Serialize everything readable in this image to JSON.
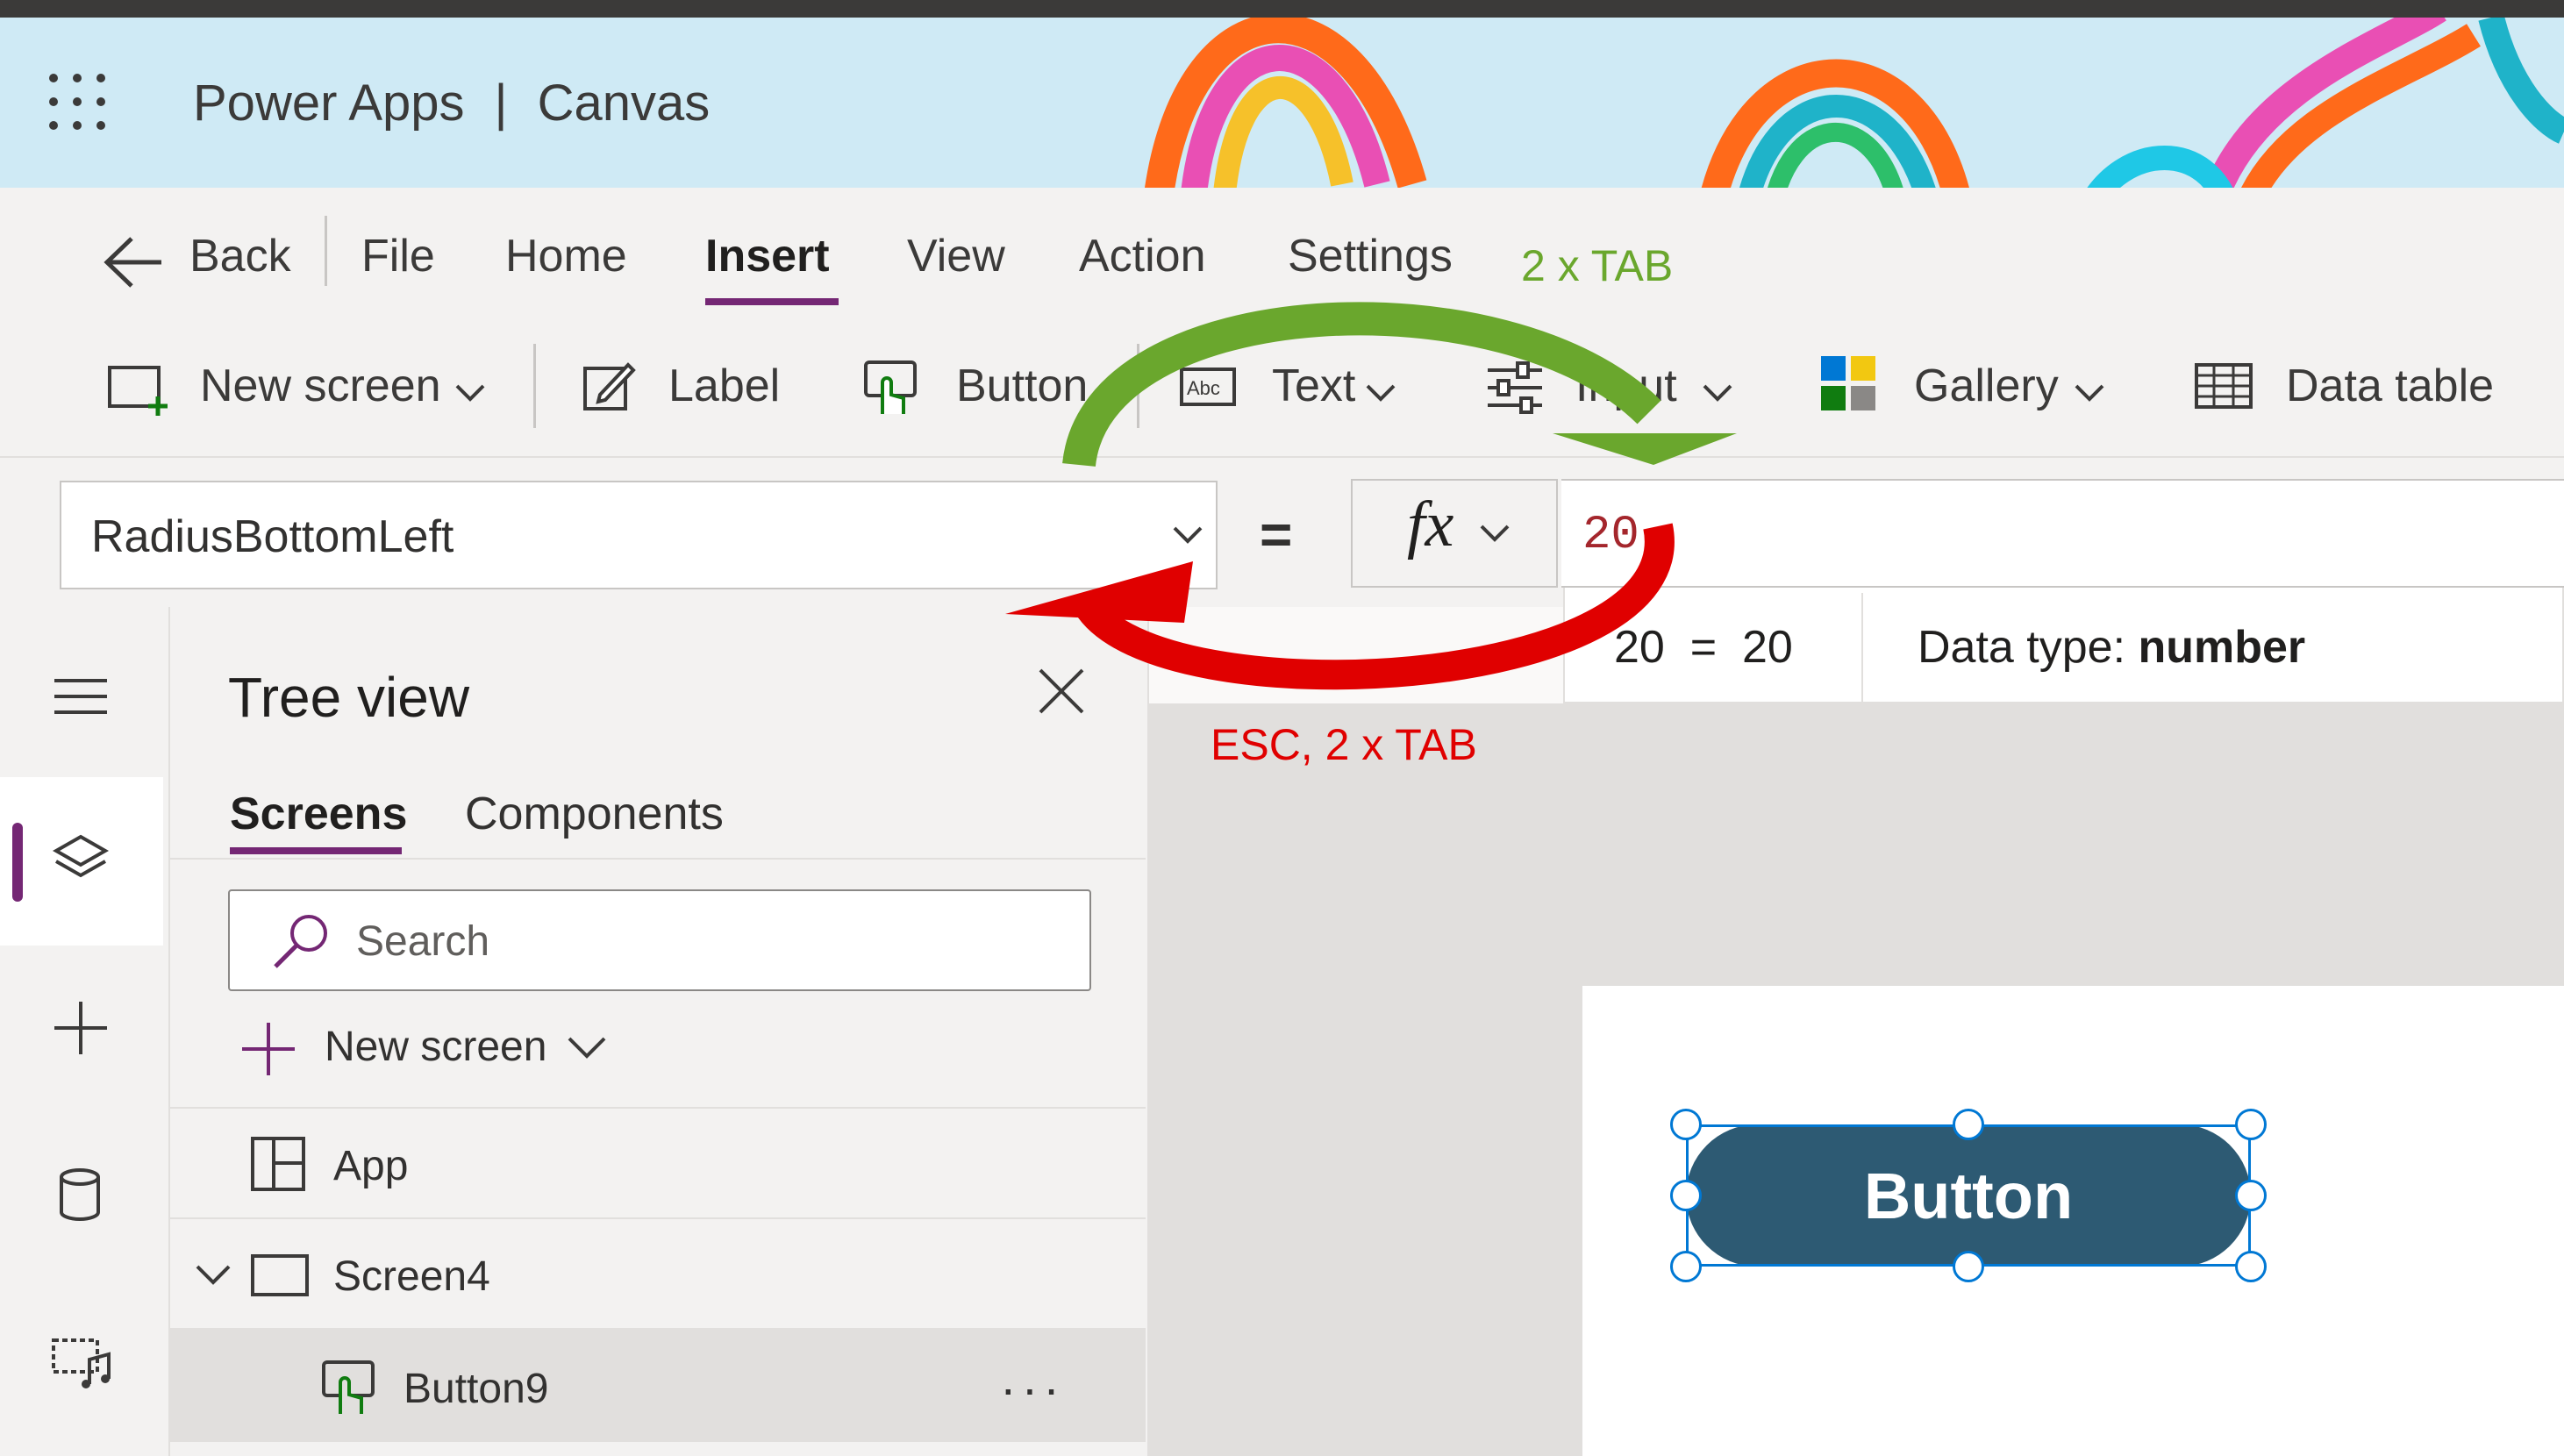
{
  "header": {
    "brand": "Power Apps",
    "separator": "|",
    "app_type": "Canvas"
  },
  "menu": {
    "back": "Back",
    "items": [
      "File",
      "Home",
      "Insert",
      "View",
      "Action",
      "Settings"
    ],
    "active": "Insert"
  },
  "toolbar": {
    "new_screen": "New screen",
    "label": "Label",
    "button": "Button",
    "text": "Text",
    "input": "Input",
    "gallery": "Gallery",
    "data_table": "Data table"
  },
  "formula_bar": {
    "property": "RadiusBottomLeft",
    "equals": "=",
    "fx": "fx",
    "formula": "20",
    "result_expr": "20  =  20",
    "data_type_label": "Data type:",
    "data_type_value": "number"
  },
  "annotations": {
    "forward": "2 x TAB",
    "backward": "ESC, 2 x TAB",
    "forward_color": "#6aa72d",
    "backward_color": "#e00000"
  },
  "tree_view": {
    "title": "Tree view",
    "tabs": [
      "Screens",
      "Components"
    ],
    "active_tab": "Screens",
    "search_placeholder": "Search",
    "new_screen": "New screen",
    "items": {
      "app": "App",
      "screen": "Screen4",
      "control": "Button9"
    },
    "more": "···"
  },
  "canvas": {
    "button_text": "Button",
    "button_color": "#2d5a73"
  },
  "colors": {
    "accent": "#742774",
    "selection": "#0078d4"
  }
}
